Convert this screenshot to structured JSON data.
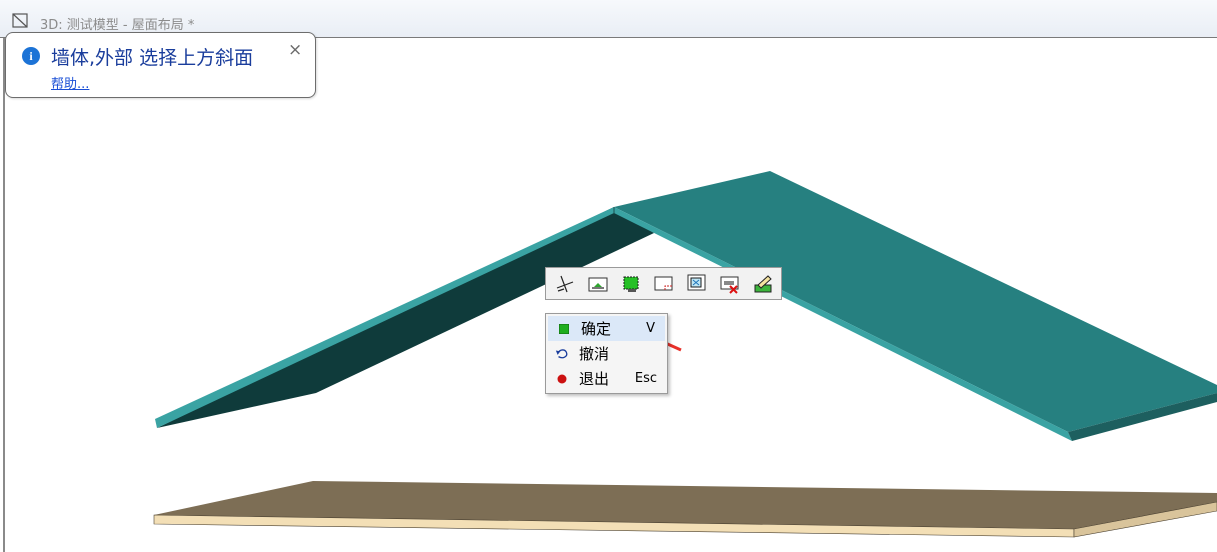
{
  "window": {
    "title": "3D: 测试模型 - 屋面布局 *"
  },
  "balloon": {
    "title": "墙体,外部 选择上方斜面",
    "help_link": "帮助...",
    "close_glyph": "×",
    "info_glyph": "i"
  },
  "toolbar": {
    "buttons": [
      {
        "icon": "trim-line-icon"
      },
      {
        "icon": "select-area-icon"
      },
      {
        "icon": "select-all-icon"
      },
      {
        "icon": "select-corner-icon"
      },
      {
        "icon": "select-window-icon"
      },
      {
        "icon": "deselect-icon"
      },
      {
        "icon": "edit-pencil-icon"
      }
    ]
  },
  "context_menu": {
    "items": [
      {
        "label": "确定",
        "shortcut": "V",
        "icon": "confirm-green-square-icon",
        "icon_color": "#1fae1f",
        "highlighted": true
      },
      {
        "label": "撤消",
        "shortcut": "",
        "icon": "undo-arrow-icon",
        "icon_color": "#1a3d9c",
        "highlighted": false
      },
      {
        "label": "退出",
        "shortcut": "Esc",
        "icon": "exit-red-dot-icon",
        "icon_color": "#cc1111",
        "highlighted": false
      }
    ]
  },
  "colors": {
    "roof_top": "#268080",
    "roof_edge": "#3aa3a3",
    "roof_underside": "#0f3b3b",
    "slab_top": "#7d6e55",
    "slab_edge": "#f3dfb6",
    "annotation_arrow": "#e8312a"
  }
}
